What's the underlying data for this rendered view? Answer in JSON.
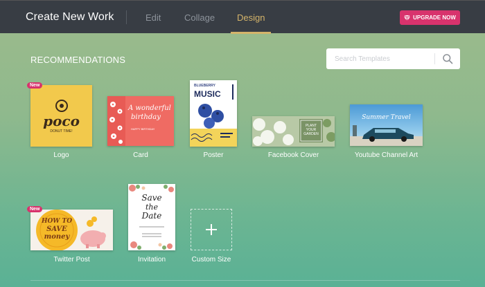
{
  "header": {
    "title": "Create New Work",
    "tabs": [
      {
        "label": "Edit",
        "active": false
      },
      {
        "label": "Collage",
        "active": false
      },
      {
        "label": "Design",
        "active": true
      }
    ],
    "upgrade_label": "UPGRADE NOW",
    "accent_color": "#d4b46a",
    "upgrade_color": "#d8336d"
  },
  "recommendations": {
    "title": "RECOMMENDATIONS",
    "search": {
      "placeholder": "Search Templates",
      "value": ""
    },
    "new_badge": "New",
    "items": [
      {
        "label": "Logo",
        "is_new": true
      },
      {
        "label": "Card",
        "is_new": false
      },
      {
        "label": "Poster",
        "is_new": false
      },
      {
        "label": "Facebook Cover",
        "is_new": false
      },
      {
        "label": "Youtube Channel Art",
        "is_new": false
      },
      {
        "label": "Twitter Post",
        "is_new": true
      },
      {
        "label": "Invitation",
        "is_new": false
      },
      {
        "label": "Custom Size",
        "is_new": false
      }
    ]
  },
  "thumb_text": {
    "logo_brand": "poco",
    "logo_tagline": "DONUT TIME!",
    "card_line1": "A wonderful",
    "card_line2": "birthday",
    "card_small": "HAPPY BIRTHDAY",
    "poster_top": "BLUEBERRY",
    "poster_title": "MUSIC",
    "fb_line1": "PLANT",
    "fb_line2": "YOUR",
    "fb_line3": "GARDEN",
    "yt_title": "Summer Travel",
    "tw_line1": "HOW TO",
    "tw_line2": "SAVE",
    "tw_line3": "money",
    "inv_line1": "Save",
    "inv_line2": "the",
    "inv_line3": "Date"
  }
}
